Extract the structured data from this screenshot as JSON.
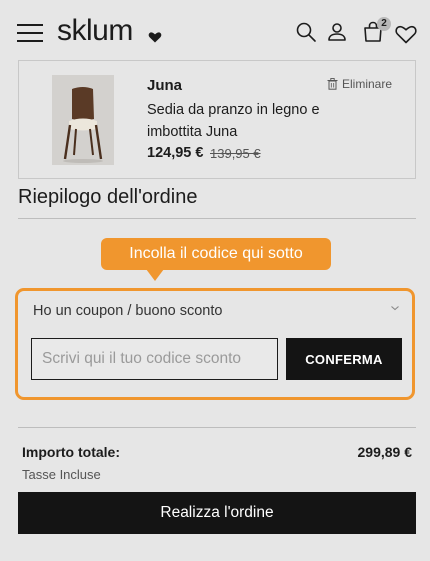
{
  "header": {
    "logo_text": "sklum",
    "cart_count": "2",
    "icons": [
      "menu-icon",
      "search-icon",
      "user-icon",
      "cart-icon",
      "heart-icon"
    ]
  },
  "product": {
    "name": "Juna",
    "description": "Sedia da pranzo in legno e imbottita Juna",
    "price": "124,95 €",
    "old_price": "139,95 €",
    "remove_label": "Eliminare"
  },
  "summary": {
    "title": "Riepilogo dell'ordine"
  },
  "coupon": {
    "tooltip": "Incolla il codice qui sotto",
    "label": "Ho un coupon / buono sconto",
    "placeholder": "Scrivi qui il tuo codice sconto",
    "value": "",
    "confirm_label": "CONFERMA"
  },
  "totals": {
    "label": "Importo totale:",
    "value": "299,89 €",
    "tax_note": "Tasse Incluse"
  },
  "order_button": "Realizza l'ordine",
  "colors": {
    "accent": "#f0962e",
    "dark": "#141414",
    "background": "#e6e6e6"
  }
}
